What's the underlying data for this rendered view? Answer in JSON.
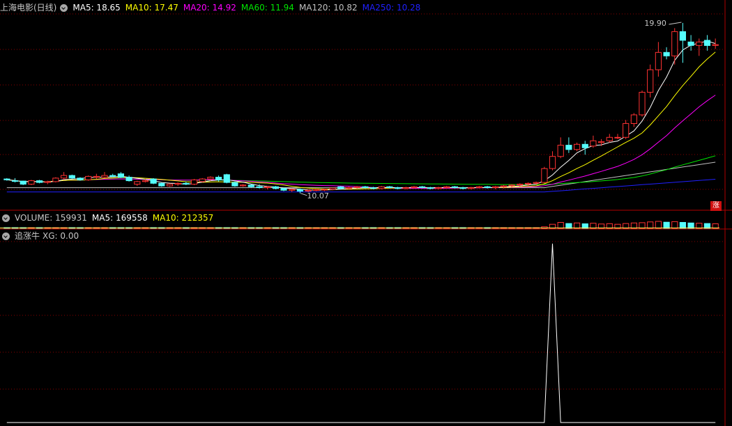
{
  "main_header": {
    "title": "上海电影(日线)",
    "ma5": "MA5: 18.65",
    "ma10": "MA10: 17.47",
    "ma20": "MA20: 14.92",
    "ma60": "MA60: 11.94",
    "ma120": "MA120: 10.82",
    "ma250": "MA250: 10.28"
  },
  "volume_header": {
    "volume": "VOLUME: 159931",
    "ma5": "MA5: 169558",
    "ma10": "MA10: 212357"
  },
  "indicator_header": {
    "name": "追涨牛",
    "xg": "XG: 0.00"
  },
  "rise_badge": "涨",
  "colors": {
    "up": "#ff3232",
    "down": "#54fcfc",
    "ma5": "#ffffff",
    "ma10": "#ffff00",
    "ma20": "#ff00ff",
    "ma60": "#00e600",
    "ma120": "#c0c0c0",
    "ma250": "#2020ff",
    "grid": "#8b0000"
  },
  "chart_data": [
    {
      "type": "candlestick",
      "title": "上海电影(日线)",
      "ylim": [
        9.5,
        20.5
      ],
      "annotations": [
        {
          "label": "19.90",
          "type": "max",
          "value": 19.9
        },
        {
          "label": "10.07",
          "type": "min",
          "value": 10.07
        }
      ],
      "candles": [
        [
          10.9,
          10.95,
          10.8,
          10.85
        ],
        [
          10.8,
          10.95,
          10.7,
          10.78
        ],
        [
          10.78,
          10.8,
          10.55,
          10.6
        ],
        [
          10.6,
          10.85,
          10.55,
          10.8
        ],
        [
          10.8,
          10.85,
          10.65,
          10.7
        ],
        [
          10.7,
          10.8,
          10.6,
          10.75
        ],
        [
          10.75,
          11.0,
          10.7,
          10.95
        ],
        [
          10.95,
          11.3,
          10.85,
          11.1
        ],
        [
          11.1,
          11.15,
          10.9,
          10.95
        ],
        [
          10.95,
          11.0,
          10.8,
          10.85
        ],
        [
          10.85,
          11.1,
          10.8,
          11.05
        ],
        [
          11.0,
          11.2,
          10.9,
          11.05
        ],
        [
          11.0,
          11.3,
          10.95,
          11.1
        ],
        [
          11.1,
          11.2,
          11.0,
          11.05
        ],
        [
          11.2,
          11.3,
          10.95,
          11.0
        ],
        [
          11.0,
          11.1,
          10.75,
          10.8
        ],
        [
          10.6,
          10.8,
          10.5,
          10.75
        ],
        [
          10.75,
          10.9,
          10.7,
          10.8
        ],
        [
          10.9,
          10.95,
          10.6,
          10.65
        ],
        [
          10.65,
          10.7,
          10.45,
          10.5
        ],
        [
          10.5,
          10.65,
          10.45,
          10.6
        ],
        [
          10.6,
          10.7,
          10.5,
          10.65
        ],
        [
          10.65,
          10.75,
          10.55,
          10.6
        ],
        [
          10.6,
          10.9,
          10.55,
          10.85
        ],
        [
          10.75,
          10.95,
          10.7,
          10.9
        ],
        [
          10.9,
          11.05,
          10.8,
          11.0
        ],
        [
          11.0,
          11.1,
          10.75,
          10.85
        ],
        [
          11.15,
          11.2,
          10.65,
          10.7
        ],
        [
          10.7,
          10.75,
          10.45,
          10.5
        ],
        [
          10.5,
          10.6,
          10.45,
          10.55
        ],
        [
          10.55,
          10.6,
          10.4,
          10.45
        ],
        [
          10.45,
          10.6,
          10.35,
          10.4
        ],
        [
          10.4,
          10.5,
          10.3,
          10.45
        ],
        [
          10.45,
          10.5,
          10.3,
          10.35
        ],
        [
          10.35,
          10.4,
          10.2,
          10.25
        ],
        [
          10.25,
          10.35,
          10.15,
          10.3
        ],
        [
          10.3,
          10.35,
          10.07,
          10.2
        ],
        [
          10.2,
          10.3,
          10.15,
          10.25
        ],
        [
          10.25,
          10.3,
          10.2,
          10.28
        ],
        [
          10.28,
          10.35,
          10.2,
          10.3
        ],
        [
          10.3,
          10.4,
          10.25,
          10.38
        ],
        [
          10.45,
          10.5,
          10.3,
          10.35
        ],
        [
          10.35,
          10.45,
          10.3,
          10.4
        ],
        [
          10.4,
          10.5,
          10.35,
          10.45
        ],
        [
          10.45,
          10.5,
          10.35,
          10.4
        ],
        [
          10.4,
          10.45,
          10.3,
          10.35
        ],
        [
          10.35,
          10.5,
          10.3,
          10.45
        ],
        [
          10.45,
          10.5,
          10.35,
          10.4
        ],
        [
          10.4,
          10.45,
          10.3,
          10.35
        ],
        [
          10.35,
          10.45,
          10.3,
          10.4
        ],
        [
          10.4,
          10.5,
          10.35,
          10.45
        ],
        [
          10.45,
          10.5,
          10.35,
          10.4
        ],
        [
          10.4,
          10.45,
          10.3,
          10.35
        ],
        [
          10.35,
          10.45,
          10.3,
          10.4
        ],
        [
          10.4,
          10.5,
          10.35,
          10.45
        ],
        [
          10.45,
          10.5,
          10.35,
          10.4
        ],
        [
          10.4,
          10.45,
          10.3,
          10.35
        ],
        [
          10.35,
          10.45,
          10.3,
          10.4
        ],
        [
          10.4,
          10.5,
          10.35,
          10.45
        ],
        [
          10.45,
          10.5,
          10.35,
          10.4
        ],
        [
          10.4,
          10.5,
          10.3,
          10.45
        ],
        [
          10.45,
          10.55,
          10.35,
          10.5
        ],
        [
          10.5,
          10.6,
          10.4,
          10.55
        ],
        [
          10.55,
          10.65,
          10.45,
          10.6
        ],
        [
          10.6,
          10.7,
          10.5,
          10.65
        ],
        [
          10.65,
          10.75,
          10.55,
          10.7
        ],
        [
          10.7,
          11.6,
          10.65,
          11.5
        ],
        [
          11.5,
          12.5,
          11.4,
          12.2
        ],
        [
          12.2,
          13.3,
          12.1,
          12.85
        ],
        [
          12.85,
          13.3,
          12.4,
          12.6
        ],
        [
          12.6,
          13.0,
          12.5,
          12.9
        ],
        [
          12.9,
          13.1,
          12.3,
          12.7
        ],
        [
          12.8,
          13.4,
          12.7,
          13.1
        ],
        [
          13.0,
          13.2,
          12.8,
          13.05
        ],
        [
          13.1,
          13.5,
          13.0,
          13.3
        ],
        [
          13.3,
          13.5,
          13.2,
          13.3
        ],
        [
          13.3,
          14.3,
          13.2,
          14.1
        ],
        [
          14.1,
          14.7,
          13.9,
          14.6
        ],
        [
          14.6,
          16.0,
          14.5,
          15.9
        ],
        [
          15.9,
          17.5,
          15.6,
          17.2
        ],
        [
          17.2,
          18.8,
          16.8,
          18.2
        ],
        [
          18.2,
          18.5,
          17.8,
          18.0
        ],
        [
          18.0,
          19.6,
          17.5,
          19.4
        ],
        [
          19.4,
          19.9,
          17.6,
          18.9
        ],
        [
          18.8,
          19.2,
          18.3,
          18.6
        ],
        [
          18.6,
          19.0,
          18.0,
          18.8
        ],
        [
          18.9,
          19.2,
          18.3,
          18.6
        ],
        [
          18.6,
          19.0,
          18.4,
          18.65
        ]
      ]
    },
    {
      "type": "bar",
      "title": "VOLUME",
      "values": [
        12,
        10,
        13,
        11,
        9,
        10,
        12,
        14,
        11,
        10,
        12,
        11,
        10,
        9,
        11,
        13,
        10,
        9,
        11,
        10,
        12,
        11,
        9,
        10,
        11,
        12,
        13,
        11,
        10,
        9,
        11,
        10,
        12,
        11,
        9,
        10,
        11,
        10,
        12,
        11,
        10,
        9,
        11,
        10,
        12,
        11,
        10,
        9,
        11,
        10,
        12,
        11,
        10,
        9,
        11,
        10,
        12,
        11,
        10,
        9,
        11,
        10,
        12,
        11,
        10,
        9,
        60,
        150,
        220,
        180,
        200,
        170,
        190,
        160,
        175,
        150,
        180,
        200,
        210,
        240,
        260,
        230,
        250,
        220,
        200,
        190,
        180,
        170
      ]
    },
    {
      "type": "line",
      "title": "追涨牛",
      "series": [
        {
          "name": "XG",
          "values": [
            0,
            0,
            0,
            0,
            0,
            0,
            0,
            0,
            0,
            0,
            0,
            0,
            0,
            0,
            0,
            0,
            0,
            0,
            0,
            0,
            0,
            0,
            0,
            0,
            0,
            0,
            0,
            0,
            0,
            0,
            0,
            0,
            0,
            0,
            0,
            0,
            0,
            0,
            0,
            0,
            0,
            0,
            0,
            0,
            0,
            0,
            0,
            0,
            0,
            0,
            0,
            0,
            0,
            0,
            0,
            0,
            0,
            0,
            0,
            0,
            0,
            0,
            0,
            0,
            0,
            0,
            0,
            1,
            0,
            0,
            0,
            0,
            0,
            0,
            0,
            0,
            0,
            0,
            0,
            0,
            0,
            0,
            0,
            0,
            0,
            0,
            0,
            0
          ]
        }
      ]
    }
  ]
}
